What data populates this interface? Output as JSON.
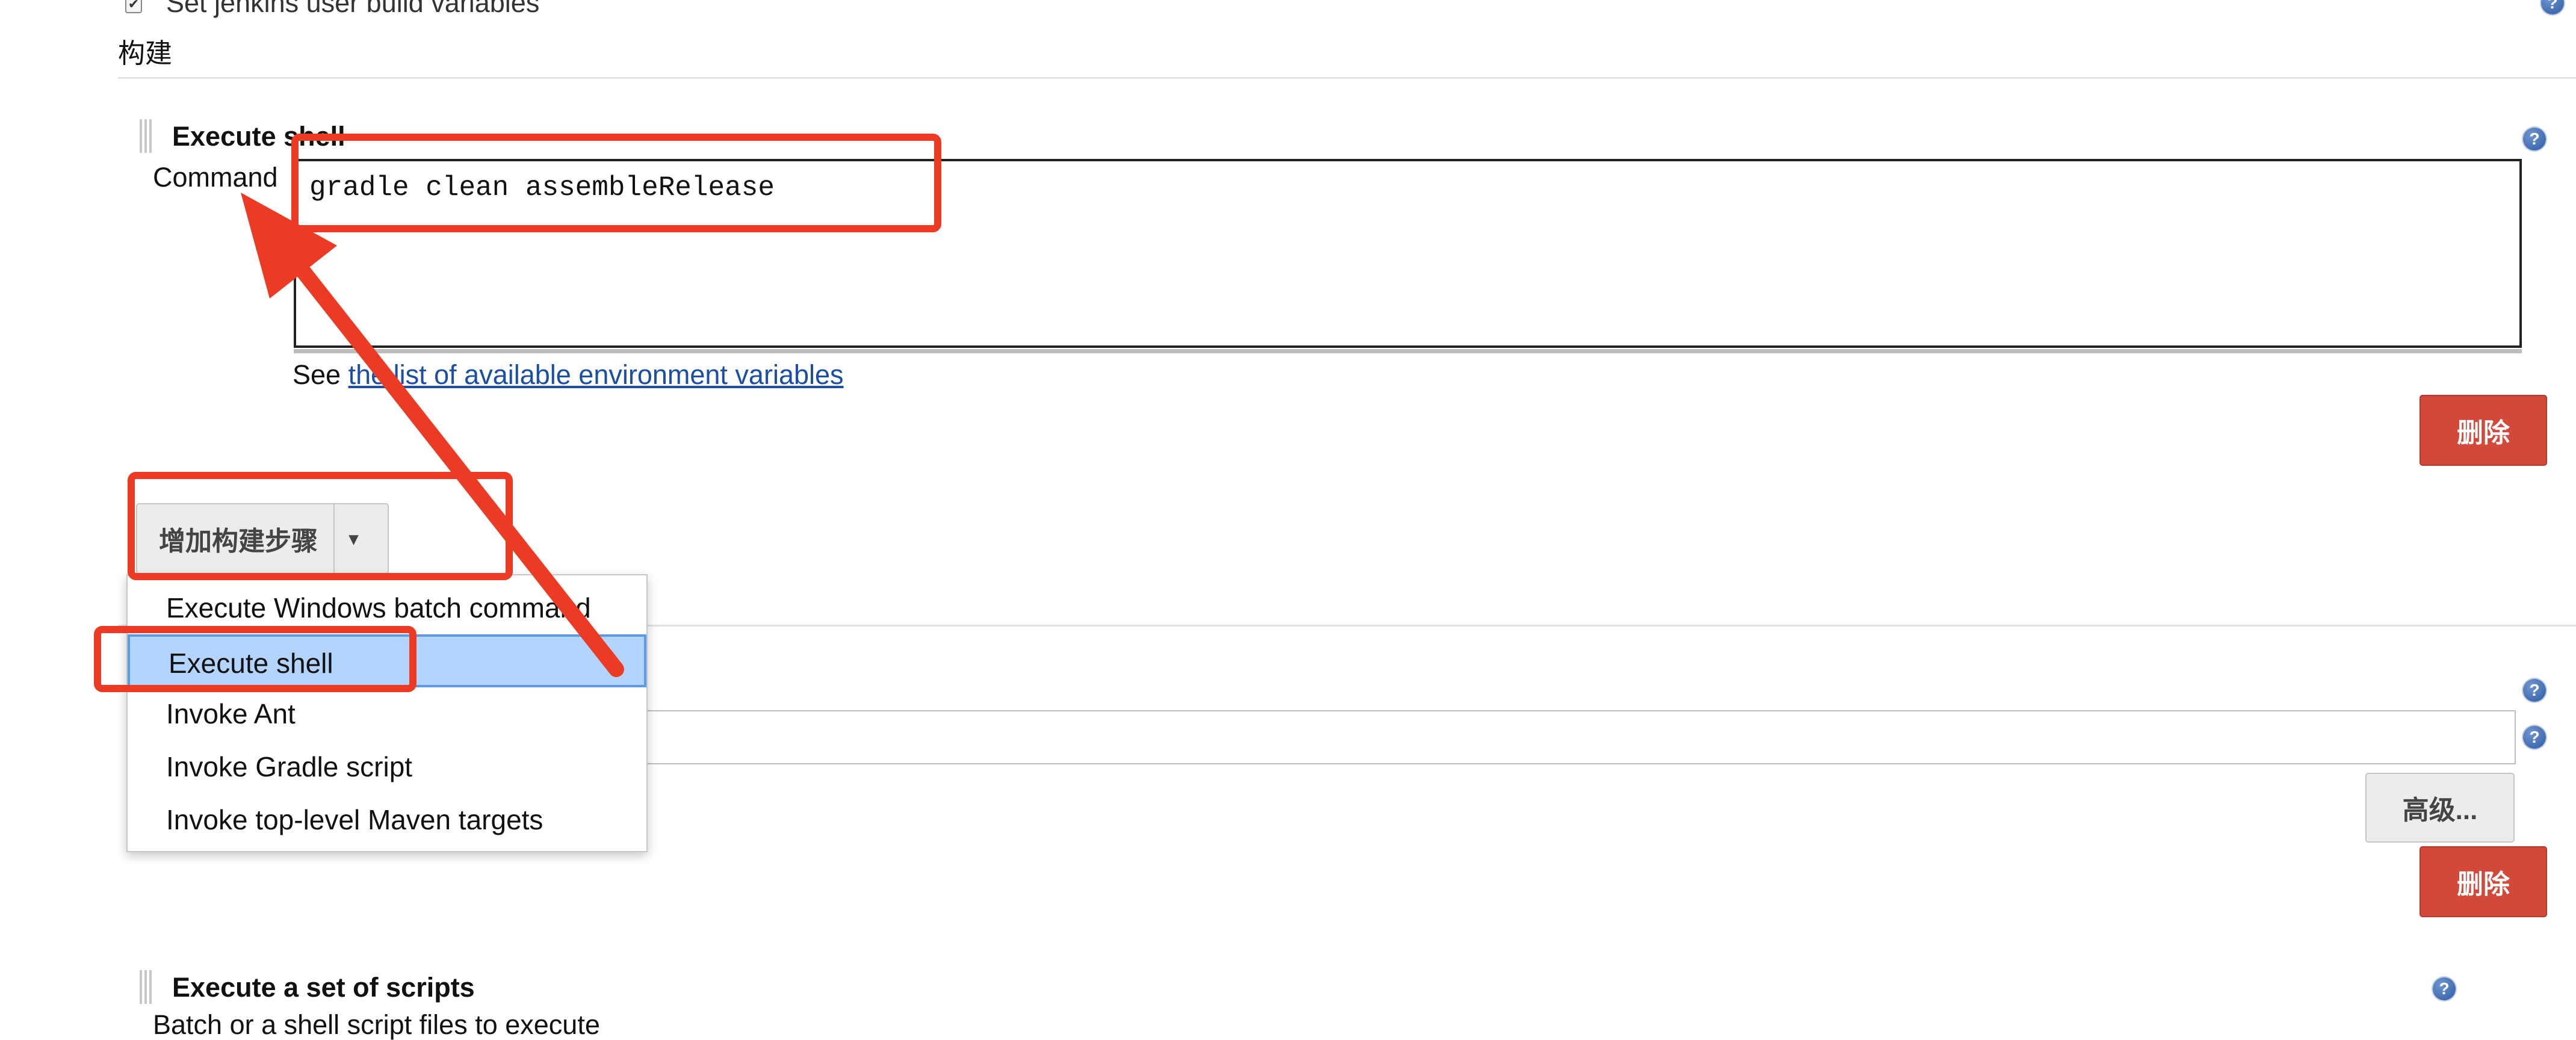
{
  "top": {
    "checkbox_label": "Set jenkins user build variables",
    "checkbox_checked": true,
    "section_title": "构建"
  },
  "execute_shell": {
    "title": "Execute shell",
    "command_label": "Command",
    "command_value": "gradle clean assembleRelease",
    "env_prefix": "See ",
    "env_link": "the list of available environment variables",
    "delete_label": "删除",
    "help_icon": "?"
  },
  "add_build_step": {
    "label": "增加构建步骤",
    "caret": "▾",
    "menu_items": [
      "Execute Windows batch command",
      "Execute shell",
      "Invoke Ant",
      "Invoke Gradle script",
      "Invoke top-level Maven targets"
    ],
    "selected_index": 1
  },
  "second_step": {
    "advanced_label": "高级...",
    "delete_label": "删除"
  },
  "scripts_step": {
    "title": "Execute a set of scripts",
    "description": "Batch or a shell script files to execute"
  },
  "colors": {
    "annotation_red": "#ec3b24",
    "delete_button": "#d24939",
    "link": "#1b4ea5",
    "menu_selected": "#b3d4fc"
  }
}
